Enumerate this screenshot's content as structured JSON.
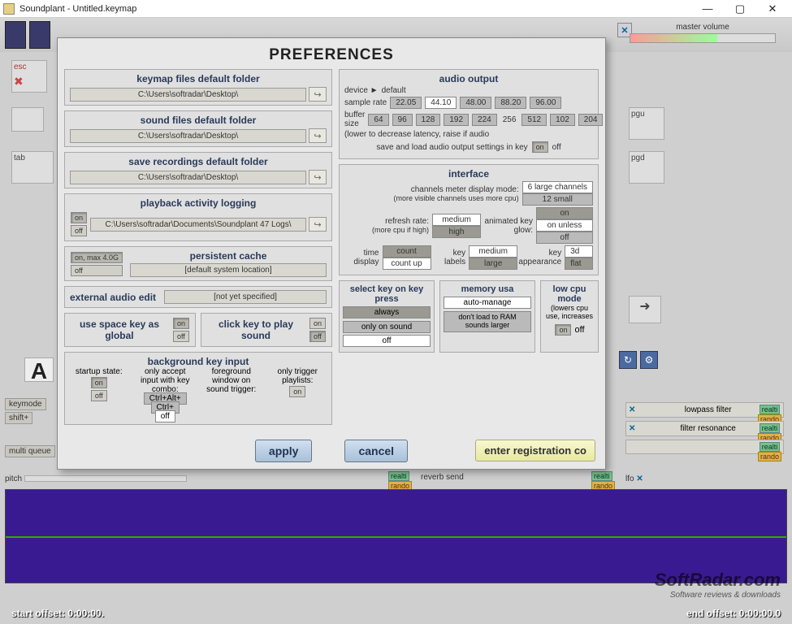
{
  "window": {
    "title": "Soundplant - Untitled.keymap"
  },
  "master_volume": "master volume",
  "keys": {
    "esc": "esc",
    "tab": "tab",
    "pgu": "pgu",
    "pgd": "pgd"
  },
  "modal_title": "PREFERENCES",
  "folders": {
    "keymap": {
      "title": "keymap files default folder",
      "path": "C:\\Users\\softradar\\Desktop\\"
    },
    "sound": {
      "title": "sound files default folder",
      "path": "C:\\Users\\softradar\\Desktop\\"
    },
    "recordings": {
      "title": "save recordings default folder",
      "path": "C:\\Users\\softradar\\Desktop\\"
    }
  },
  "logging": {
    "title": "playback activity logging",
    "path": "C:\\Users\\softradar\\Documents\\Soundplant 47 Logs\\",
    "on": "on",
    "off": "off"
  },
  "cache": {
    "title": "persistent cache",
    "on": "on, max 4.0G",
    "off": "off",
    "loc": "[default system location]"
  },
  "external": {
    "title": "external audio edit",
    "val": "[not yet specified]"
  },
  "space": {
    "title": "use space key as global",
    "on": "on",
    "off": "off"
  },
  "click": {
    "title": "click key to play sound",
    "on": "on",
    "off": "off"
  },
  "bg": {
    "title": "background key input",
    "startup": "startup state:",
    "only_accept": "only accept input with key combo:",
    "ctrlalt": "Ctrl+Alt+",
    "ctrl": "Ctrl+",
    "fg": "foreground window on sound trigger:",
    "only_trigger": "only trigger playlists:",
    "on": "on",
    "off": "off"
  },
  "audio": {
    "title": "audio output",
    "device_label": "device ►",
    "device_val": "default",
    "sr_label": "sample rate",
    "sr": [
      "22.05",
      "44.10",
      "48.00",
      "88.20",
      "96.00"
    ],
    "buf_label": "buffer size",
    "buf": [
      "64",
      "96",
      "128",
      "192",
      "224",
      "256",
      "512",
      "102",
      "204"
    ],
    "note": "(lower to decrease latency, raise if audio",
    "save_label": "save and load audio output settings in key",
    "on": "on",
    "off": "off"
  },
  "iface": {
    "title": "interface",
    "channels_label": "channels meter display mode:",
    "channels_note": "(more visible channels uses more cpu)",
    "ch_opt1": "6 large channels",
    "ch_opt2": "12 small",
    "refresh_label": "refresh rate:",
    "refresh_note": "(more cpu if high)",
    "refresh_med": "medium",
    "refresh_high": "high",
    "glow_label": "animated key glow:",
    "glow_on": "on",
    "glow_unless": "on unless",
    "glow_off": "off",
    "time_label": "time display",
    "time_count": "count",
    "time_countup": "count up",
    "keylabels_label": "key labels",
    "kl_med": "medium",
    "kl_large": "large",
    "keyapp_label": "key appearance",
    "ka_3d": "3d",
    "ka_flat": "flat"
  },
  "selectkey": {
    "title": "select key on key press",
    "always": "always",
    "onlysound": "only on sound",
    "off": "off"
  },
  "mem": {
    "title": "memory usa",
    "auto": "auto-manage",
    "dont": "don't load to RAM sounds larger"
  },
  "lowcpu": {
    "title": "low cpu mode",
    "note": "(lowers cpu use, increases",
    "on": "on",
    "off": "off"
  },
  "apply": "apply",
  "cancel": "cancel",
  "register": "enter registration co",
  "bgctrls": {
    "keymode": "keymode",
    "shift": "shift+",
    "multiqueue": "multi queue",
    "off": "off",
    "pitch": "pitch",
    "reverb": "reverb send",
    "lfo": "lfo",
    "realti": "realti",
    "rando": "rando"
  },
  "filter": {
    "lowpass": "lowpass filter",
    "resonance": "filter resonance"
  },
  "offsets": {
    "start": "start offset: 0:00:00.",
    "end": "end offset: 0:00:00.0"
  },
  "watermark": {
    "name": "SoftRadar.com",
    "sub": "Software reviews & downloads"
  },
  "bigA": "A"
}
